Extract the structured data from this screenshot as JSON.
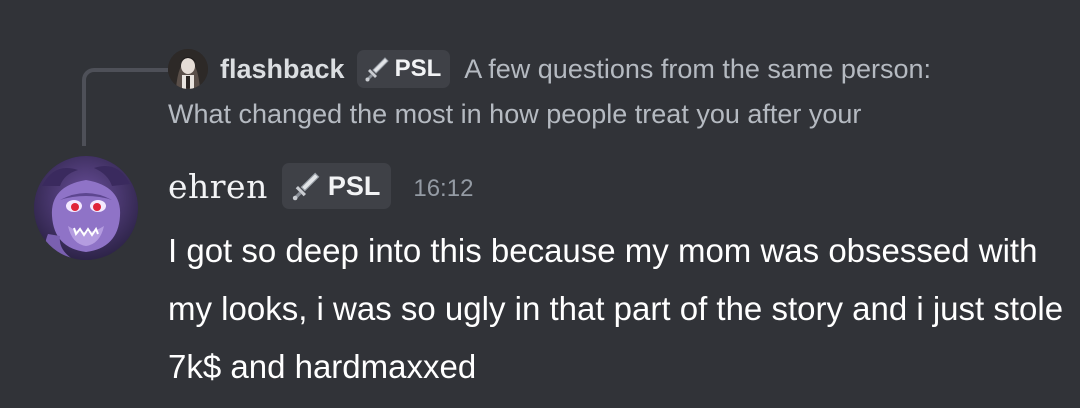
{
  "reply": {
    "author": "flashback",
    "role_tag": "PSL",
    "text_line1": "A few questions from the same person:",
    "text_line2": "What changed the most in how people treat you after your",
    "avatar_icon": "profile-photo-icon"
  },
  "message": {
    "author": "ehren",
    "role_tag": "PSL",
    "tag_icon": "sword-icon",
    "timestamp": "16:12",
    "content": "I got so deep into this because my mom was obsessed with my looks, i was so ugly in that part of the story and i just stole 7k$ and hardmaxxed",
    "avatar_icon": "purple-cartoon-creature-icon"
  },
  "colors": {
    "background": "#313338",
    "tag_background": "#3f4147",
    "reply_text": "#b5bac1",
    "timestamp": "#949ba4",
    "content_text": "#ffffff"
  }
}
